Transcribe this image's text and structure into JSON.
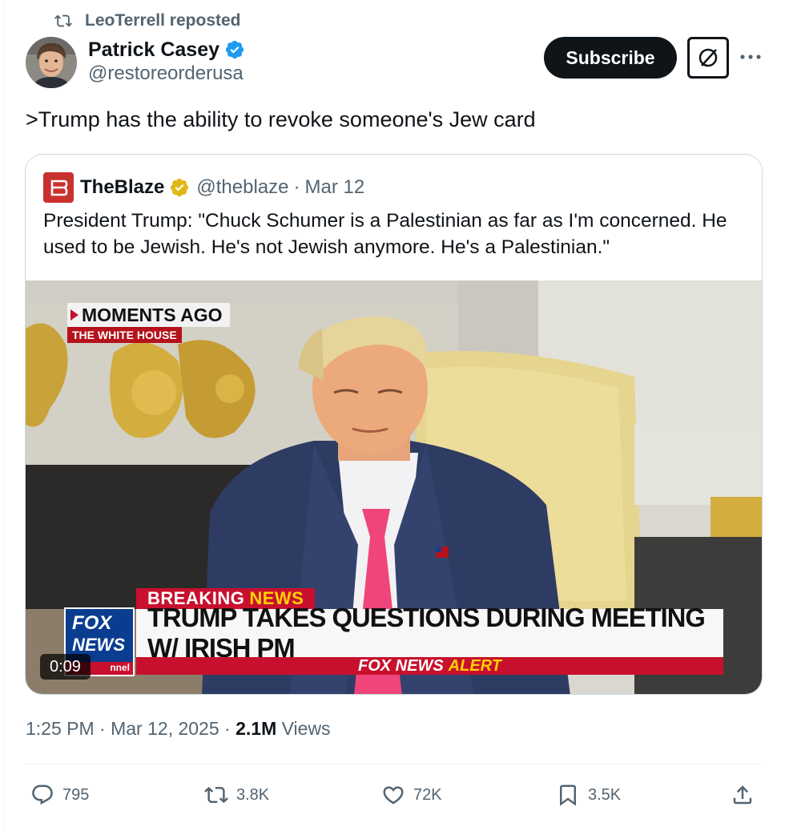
{
  "repost": {
    "text": "LeoTerrell reposted",
    "icon": "repost-icon"
  },
  "author": {
    "name": "Patrick Casey",
    "handle": "@restoreorderusa",
    "verified_color": "#1d9bf0"
  },
  "header_actions": {
    "subscribe_label": "Subscribe",
    "grok_icon": "grok-icon",
    "more_icon": "more-icon"
  },
  "tweet": {
    "text": ">Trump has the ability to revoke someone's Jew card"
  },
  "quote": {
    "name": "TheBlaze",
    "handle": "@theblaze",
    "separator": "·",
    "date": "Mar 12",
    "gold_badge_color": "#e2b719",
    "text": "President Trump: \"Chuck Schumer is a Palestinian as far as I'm concerned. He used to be Jewish. He's not Jewish anymore. He's a Palestinian.\"",
    "media": {
      "overlay_top": "MOMENTS AGO",
      "overlay_location": "THE WHITE HOUSE",
      "breaking_label_1": "BREAKING",
      "breaking_label_2": "NEWS",
      "headline": "TRUMP TAKES QUESTIONS DURING MEETING W/ IRISH PM",
      "alert_part_1": "FOX NEWS",
      "alert_part_2": "ALERT",
      "logo_line_1": "FOX",
      "logo_line_2": "NEWS",
      "logo_line_3": "nnel",
      "timer": "0:09"
    }
  },
  "meta": {
    "time": "1:25 PM",
    "sep1": "·",
    "date": "Mar 12, 2025",
    "sep2": "·",
    "views_count": "2.1M",
    "views_label": "Views"
  },
  "actions": {
    "replies": "795",
    "reposts": "3.8K",
    "likes": "72K",
    "bookmarks": "3.5K"
  },
  "colors": {
    "text_primary": "#0f1419",
    "text_secondary": "#536471",
    "border": "#cfd9de",
    "fox_red": "#c8102e",
    "fox_blue": "#0a3d8f"
  }
}
